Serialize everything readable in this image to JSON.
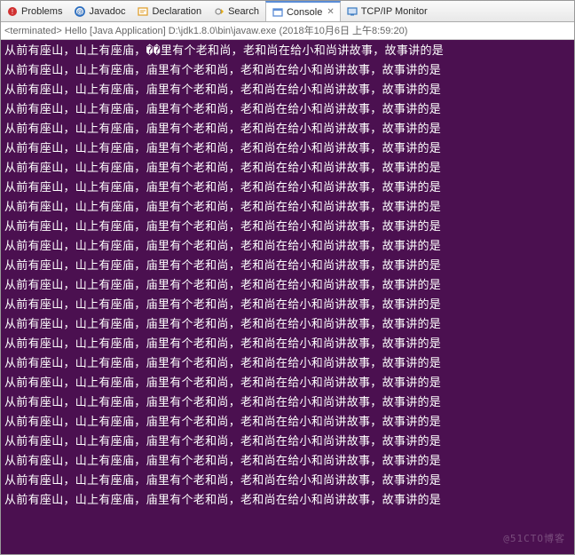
{
  "tabs": [
    {
      "label": "Problems",
      "icon_color": "#d03030"
    },
    {
      "label": "Javadoc",
      "icon_color": "#2a6dc0"
    },
    {
      "label": "Declaration",
      "icon_color": "#e0a030"
    },
    {
      "label": "Search",
      "icon_color": "#f0b000"
    },
    {
      "label": "Console",
      "icon_color": "#5a8cd6",
      "active": true,
      "closable": true
    },
    {
      "label": "TCP/IP Monitor",
      "icon_color": "#3a7ac0"
    }
  ],
  "status": {
    "prefix": "<terminated>",
    "app_name": "Hello",
    "launch_type": "[Java Application]",
    "path": "D:\\jdk1.8.0\\bin\\javaw.exe",
    "timestamp": "(2018年10月6日 上午8:59:20)"
  },
  "console": {
    "background": "#4b1050",
    "foreground": "#ffffff",
    "first_line": "从前有座山，山上有座庙，��里有个老和尚，老和尚在给小和尚讲故事，故事讲的是",
    "repeat_line": "从前有座山，山上有座庙，庙里有个老和尚，老和尚在给小和尚讲故事，故事讲的是",
    "line_count": 24
  },
  "watermark": "@51CTO博客"
}
